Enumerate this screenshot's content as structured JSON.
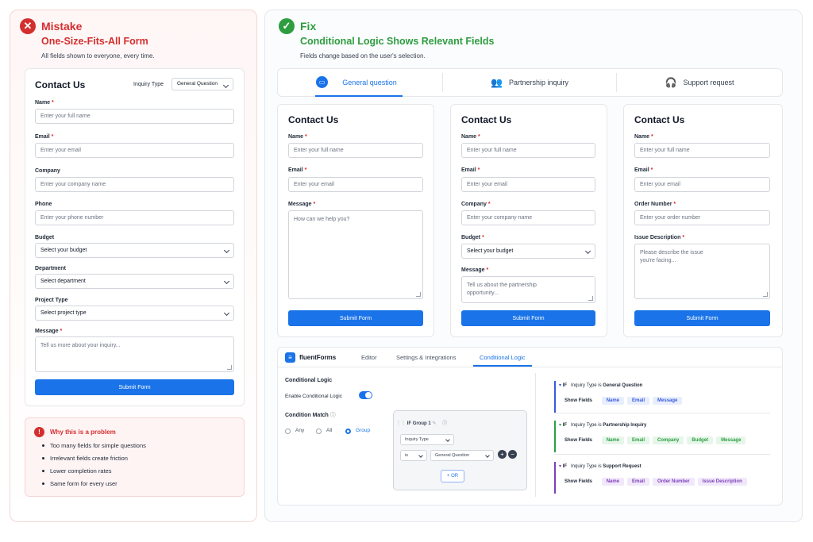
{
  "colors": {
    "mistake": "#d32f2f",
    "fix": "#2e9d3f",
    "primary": "#1a73e8"
  },
  "mistake": {
    "title": "Mistake",
    "subtitle": "One-Size-Fits-All Form",
    "description": "All fields shown to everyone, every time.",
    "form": {
      "title": "Contact Us",
      "inquiry_label": "Inquiry Type",
      "inquiry_value": "General Question",
      "fields": [
        {
          "label": "Name",
          "req": "*",
          "placeholder": "Enter your full name"
        },
        {
          "label": "Email",
          "req": "*",
          "placeholder": "Enter your email"
        },
        {
          "label": "Company",
          "req": "",
          "placeholder": "Enter your company name"
        },
        {
          "label": "Phone",
          "req": "",
          "placeholder": "Enter your phone number"
        },
        {
          "label": "Budget",
          "req": "",
          "placeholder": "Select your budget"
        },
        {
          "label": "Department",
          "req": "",
          "placeholder": "Select department"
        },
        {
          "label": "Project Type",
          "req": "",
          "placeholder": "Select project type"
        },
        {
          "label": "Message",
          "req": "*",
          "placeholder": "Tell us more about your inquiry..."
        }
      ],
      "submit": "Submit Form"
    },
    "problem": {
      "title": "Why this is a problem",
      "items": [
        "Too many fields for simple questions",
        "Irrelevant fields create friction",
        "Lower completion rates",
        "Same form for every user"
      ]
    }
  },
  "fix": {
    "title": "Fix",
    "subtitle": "Conditional Logic Shows Relevant Fields",
    "description": "Fields change based on the user's selection.",
    "tabs": [
      "General question",
      "Partnership inquiry",
      "Support request"
    ],
    "forms": [
      {
        "title": "Contact Us",
        "fields": [
          {
            "label": "Name",
            "req": "*",
            "placeholder": "Enter your full name"
          },
          {
            "label": "Email",
            "req": "*",
            "placeholder": "Enter your email"
          },
          {
            "label": "Message",
            "req": "*",
            "placeholder": "How can we help you?"
          }
        ],
        "submit": "Submit Form"
      },
      {
        "title": "Contact Us",
        "fields": [
          {
            "label": "Name",
            "req": "*",
            "placeholder": "Enter your full name"
          },
          {
            "label": "Email",
            "req": "*",
            "placeholder": "Enter your email"
          },
          {
            "label": "Company",
            "req": "*",
            "placeholder": "Enter your company name"
          },
          {
            "label": "Budget",
            "req": "*",
            "placeholder": "Select your budget"
          },
          {
            "label": "Message",
            "req": "*",
            "placeholder": "Tell us about the partnership opportunity..."
          }
        ],
        "submit": "Submit Form"
      },
      {
        "title": "Contact Us",
        "fields": [
          {
            "label": "Name",
            "req": "*",
            "placeholder": "Enter your full name"
          },
          {
            "label": "Email",
            "req": "*",
            "placeholder": "Enter your email"
          },
          {
            "label": "Order Number",
            "req": "*",
            "placeholder": "Enter your order number"
          },
          {
            "label": "Issue Description",
            "req": "*",
            "placeholder": "Please describe the issue you're facing..."
          }
        ],
        "submit": "Submit Form"
      }
    ],
    "builder": {
      "brand": "fluentForms",
      "tabs": [
        "Editor",
        "Settings & Integrations",
        "Conditional Logic"
      ],
      "section_title": "Conditional Logic",
      "enable_label": "Enable Conditional Logic",
      "condition_label": "Condition Match",
      "radios": [
        "Any",
        "All",
        "Group"
      ],
      "group": {
        "if": "IF",
        "name": "Group 1",
        "field": "Inquiry Type",
        "op": "is",
        "value": "General Question",
        "or": "+ OR"
      },
      "rules": [
        {
          "if": "IF",
          "text": "Inquiry Type is",
          "value": "General Question",
          "show": "Show Fields",
          "fields": [
            "Name",
            "Email",
            "Message"
          ]
        },
        {
          "if": "IF",
          "text": "Inquiry Type is",
          "value": "Partnership Inquiry",
          "show": "Show Fields",
          "fields": [
            "Name",
            "Email",
            "Company",
            "Budget",
            "Message"
          ]
        },
        {
          "if": "IF",
          "text": "Inquiry Type is",
          "value": "Support Request",
          "show": "Show Fields",
          "fields": [
            "Name",
            "Email",
            "Order Number",
            "Issue Description"
          ]
        }
      ]
    }
  }
}
